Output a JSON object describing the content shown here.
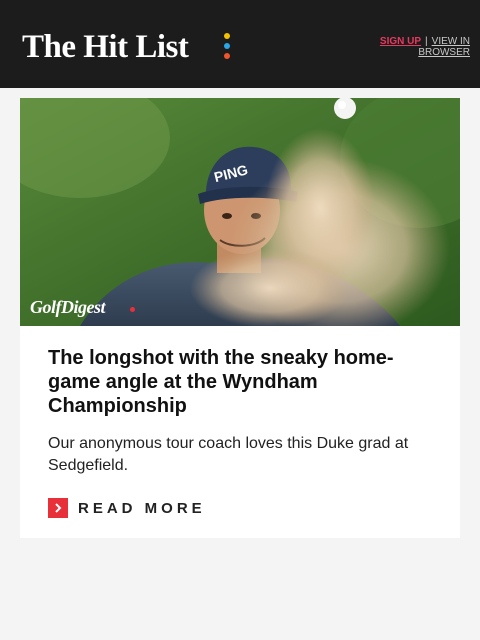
{
  "header": {
    "logo_text": "The Hit List",
    "sign_up": "SIGN UP",
    "separator": "|",
    "view_in_browser": "VIEW IN BROWSER"
  },
  "article": {
    "image_brand": "GolfDigest",
    "headline": "The longshot with the sneaky home-game angle at the Wyndham Championship",
    "deck": "Our anonymous tour coach loves this Duke grad at Sedgefield.",
    "cta_label": "READ MORE",
    "cta_icon": "chevron-right-icon"
  },
  "colors": {
    "header_bg": "#1c1c1c",
    "accent_red": "#e8303a",
    "sign_up": "#e53a5f",
    "logo_dots": [
      "#f5c200",
      "#2aa7e8",
      "#f0552b"
    ]
  }
}
